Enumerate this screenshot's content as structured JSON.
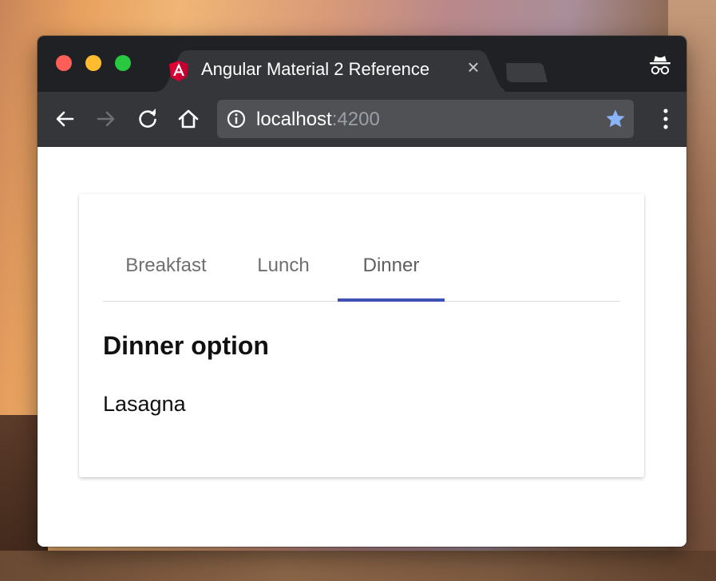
{
  "browser": {
    "tab_title": "Angular Material 2 Reference",
    "url_host": "localhost",
    "url_port": ":4200"
  },
  "icons": {
    "back": "arrow-left-icon",
    "forward": "arrow-right-icon",
    "reload": "reload-icon",
    "home": "home-icon",
    "info": "info-icon",
    "bookmark": "star-icon",
    "menu": "kebab-menu-icon",
    "incognito": "incognito-icon",
    "favicon": "angular-logo-icon",
    "close": "close-icon"
  },
  "colors": {
    "accent": "#3f51b5",
    "star": "#8ab4f8",
    "titlebar": "#202124",
    "toolbar": "#35363a",
    "angular_red": "#dd0031"
  },
  "page": {
    "tabs": [
      {
        "label": "Breakfast",
        "active": false
      },
      {
        "label": "Lunch",
        "active": false
      },
      {
        "label": "Dinner",
        "active": true
      }
    ],
    "heading": "Dinner option",
    "body": "Lasagna"
  }
}
